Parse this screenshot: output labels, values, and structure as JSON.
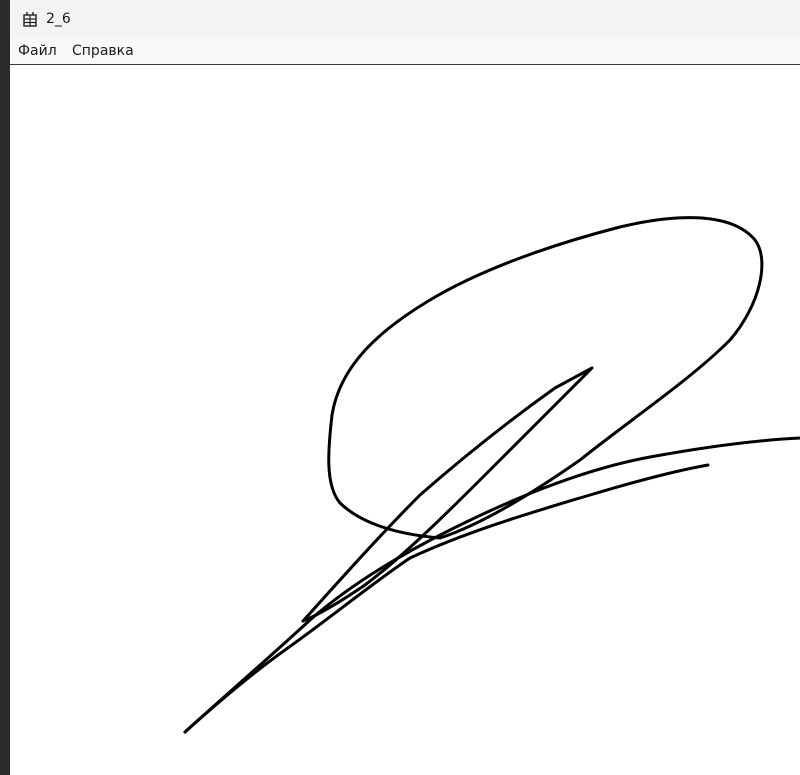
{
  "window": {
    "title": "2_6",
    "icon": "app-grid-icon"
  },
  "menu": {
    "file_label": "Файл",
    "help_label": "Справка"
  },
  "canvas": {
    "background": "#ffffff",
    "stroke_color": "#000000"
  }
}
